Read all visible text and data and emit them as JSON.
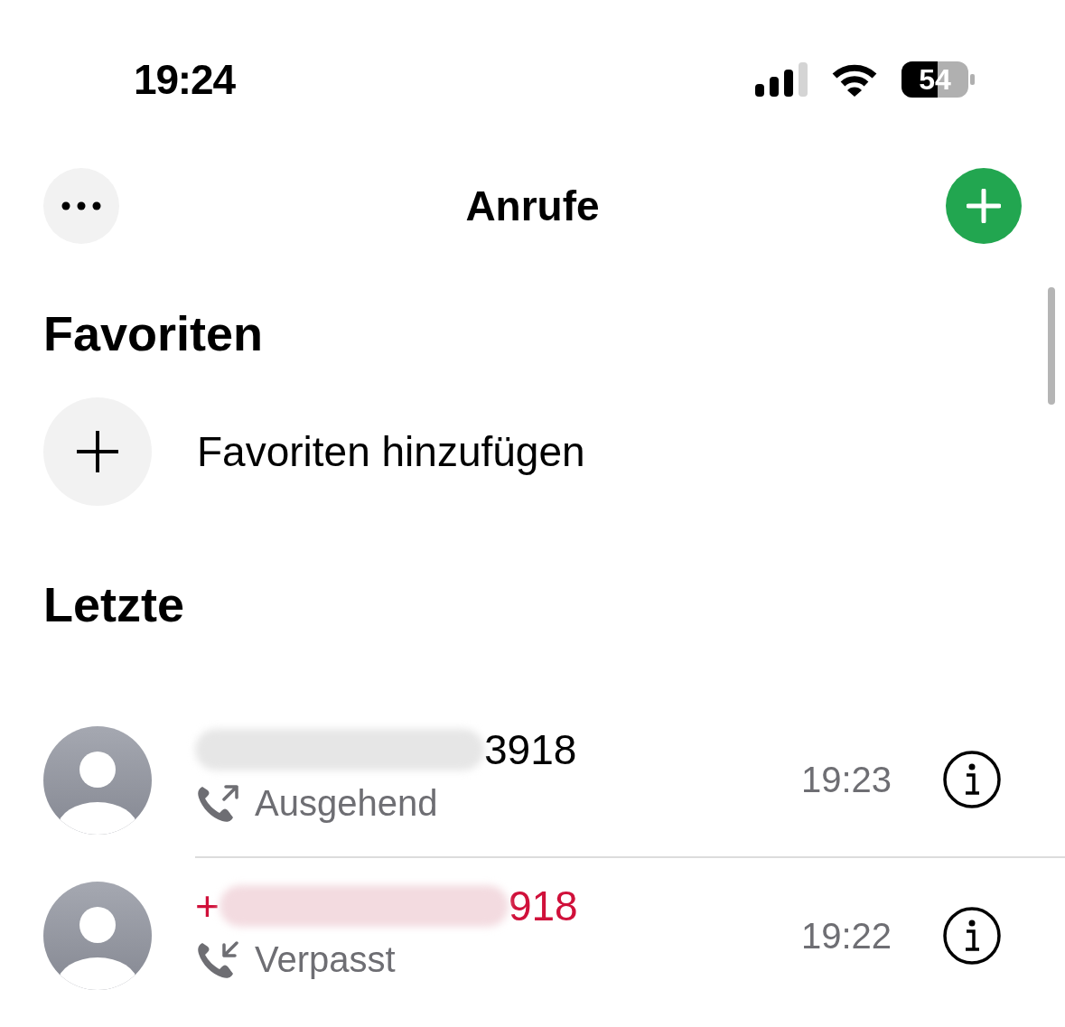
{
  "status_bar": {
    "time": "19:24",
    "battery": "54"
  },
  "header": {
    "title": "Anrufe"
  },
  "favorites": {
    "heading": "Favoriten",
    "add_label": "Favoriten hinzufügen"
  },
  "recents": {
    "heading": "Letzte",
    "calls": [
      {
        "kind": "outgoing",
        "suffix": "3918",
        "status": "Ausgehend",
        "time": "19:23"
      },
      {
        "kind": "missed",
        "prefix": "+",
        "suffix": "918",
        "status": "Verpasst",
        "time": "19:22"
      }
    ]
  }
}
